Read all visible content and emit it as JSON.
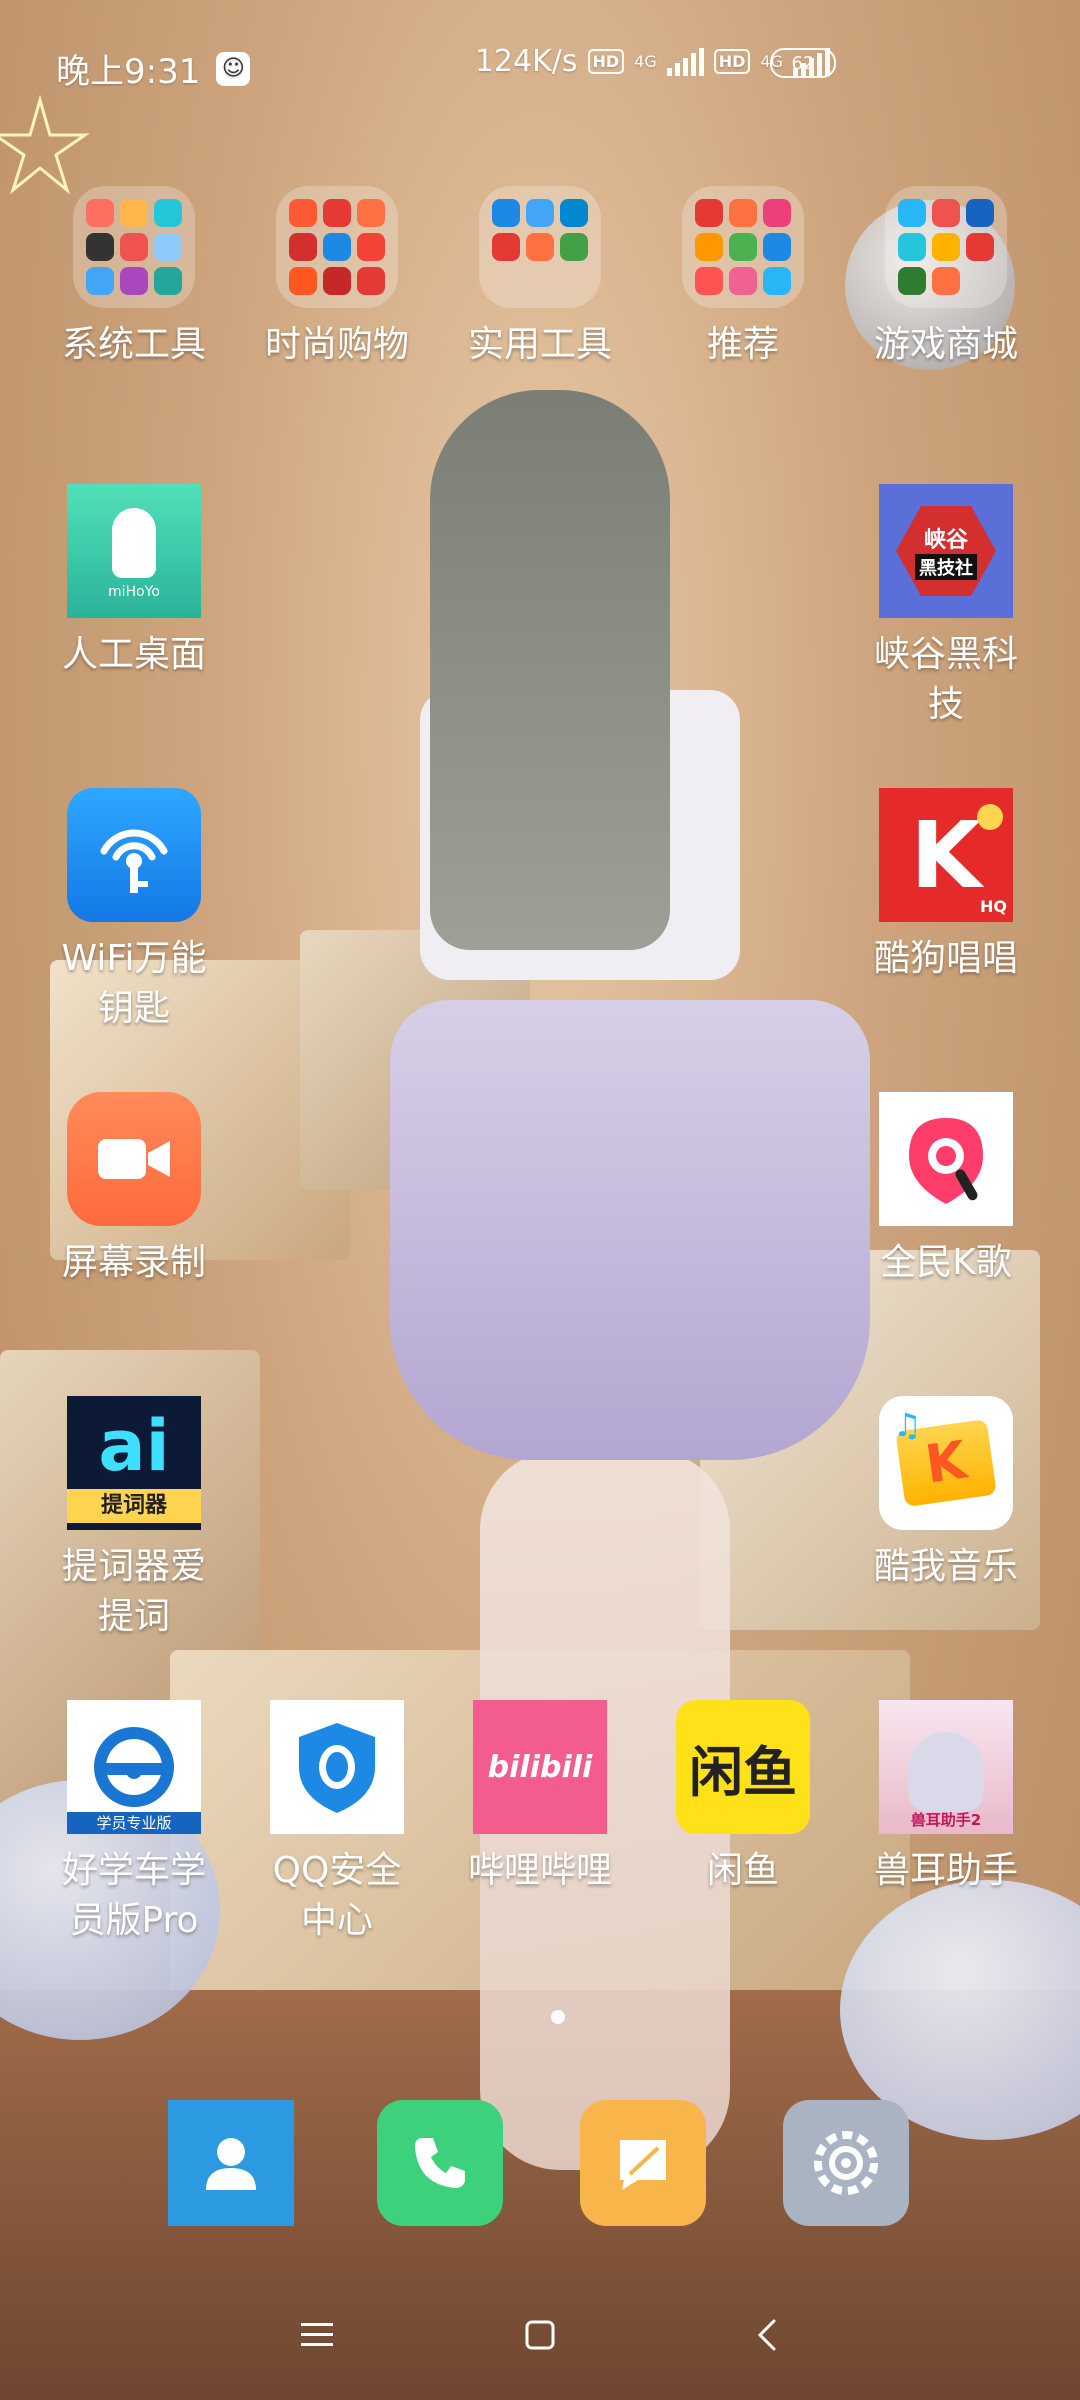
{
  "status_bar": {
    "time": "晚上9:31",
    "speed": "124K/s",
    "hd1": "HD",
    "network1": "4G",
    "hd2": "HD",
    "network2": "4G",
    "battery": "62"
  },
  "folders": [
    {
      "label": "系统工具",
      "icon": "folder-system-tools-icon"
    },
    {
      "label": "时尚购物",
      "icon": "folder-shopping-icon"
    },
    {
      "label": "实用工具",
      "icon": "folder-utilities-icon"
    },
    {
      "label": "推荐",
      "icon": "folder-recommended-icon"
    },
    {
      "label": "游戏商城",
      "icon": "folder-game-store-icon"
    }
  ],
  "apps": {
    "ai_desktop": {
      "label": "人工桌面",
      "brand": "miHoYo"
    },
    "xiagu": {
      "label_line1": "峡谷黑科",
      "label_line2": "技",
      "icon_text_1": "峡谷",
      "icon_text_2": "黑技社"
    },
    "wifi": {
      "label_line1": "WiFi万能",
      "label_line2": "钥匙"
    },
    "kugou_sing": {
      "label": "酷狗唱唱",
      "icon_text": "K",
      "badge": "HQ"
    },
    "screen_record": {
      "label": "屏幕录制"
    },
    "quanmin_k": {
      "label": "全民K歌"
    },
    "prompter": {
      "label_line1": "提词器爱",
      "label_line2": "提词",
      "icon_text": "提词器"
    },
    "kuwo": {
      "label": "酷我音乐",
      "icon_text": "K"
    },
    "haoxueche": {
      "label_line1": "好学车学",
      "label_line2": "员版Pro",
      "icon_text": "学员专业版"
    },
    "qq_safe": {
      "label_line1": "QQ安全",
      "label_line2": "中心"
    },
    "bilibili": {
      "label": "哔哩哔哩",
      "icon_text": "bilibili"
    },
    "xianyu": {
      "label": "闲鱼",
      "icon_text": "闲鱼"
    },
    "erzhu": {
      "label": "兽耳助手",
      "icon_text": "兽耳助手2"
    }
  },
  "dock": [
    "contacts",
    "phone",
    "messages",
    "settings"
  ],
  "colors": {
    "wallpaper": "#cda47d",
    "wifi_blue": "#1a8cf0",
    "kugou_red": "#e52a2a",
    "record_orange": "#ff7a45",
    "bilibili_pink": "#f25d8e",
    "xianyu_yellow": "#ffe11a",
    "contacts_blue": "#2b9ae0",
    "phone_green": "#3cd17a",
    "message_orange": "#f7b54a"
  }
}
